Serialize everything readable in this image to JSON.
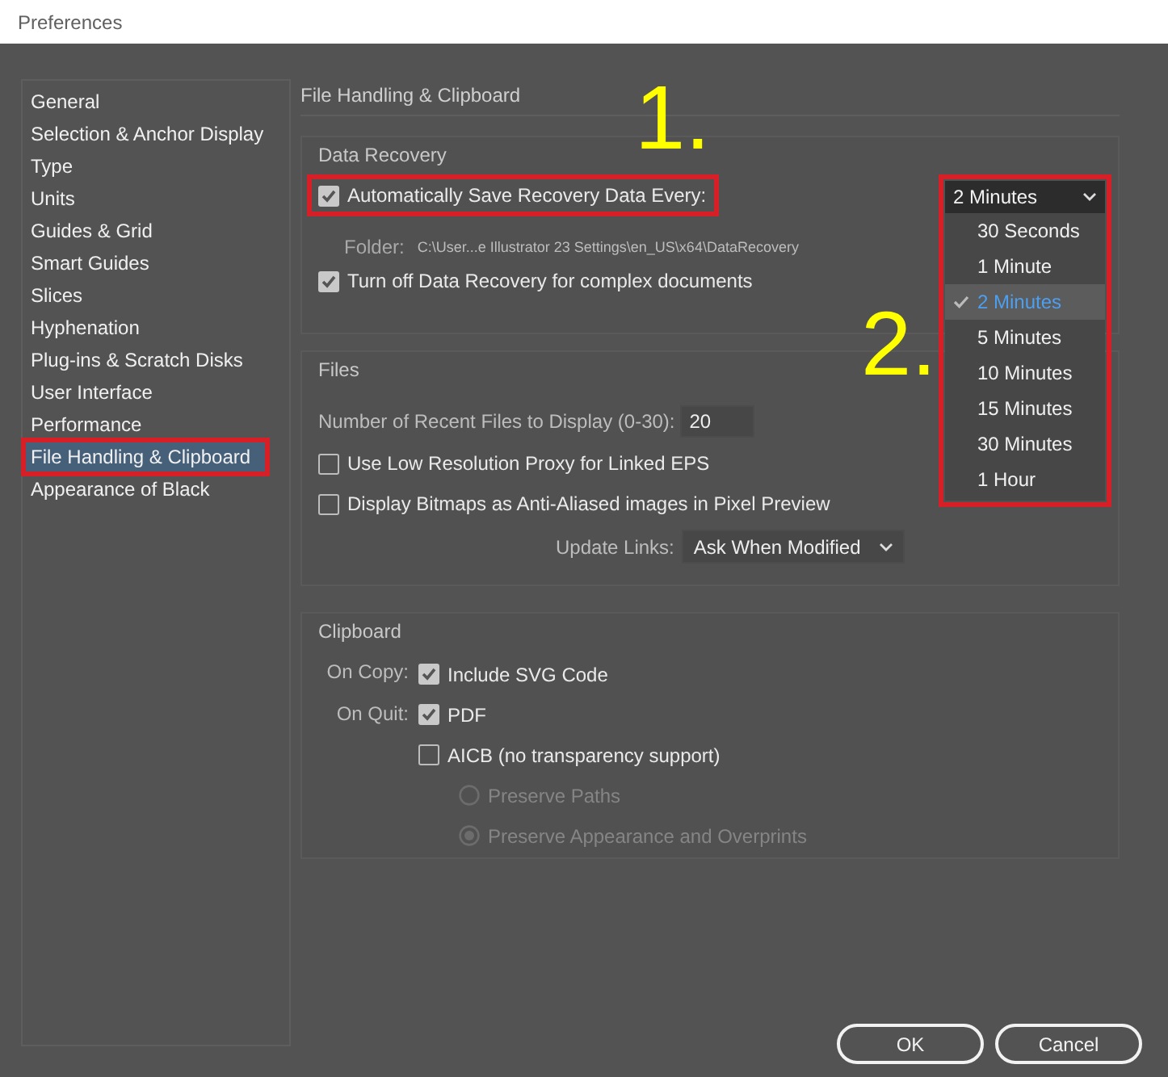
{
  "window": {
    "title": "Preferences"
  },
  "sidebar": {
    "items": [
      {
        "label": "General",
        "selected": false,
        "highlighted": false
      },
      {
        "label": "Selection & Anchor Display",
        "selected": false,
        "highlighted": false
      },
      {
        "label": "Type",
        "selected": false,
        "highlighted": false
      },
      {
        "label": "Units",
        "selected": false,
        "highlighted": false
      },
      {
        "label": "Guides & Grid",
        "selected": false,
        "highlighted": false
      },
      {
        "label": "Smart Guides",
        "selected": false,
        "highlighted": false
      },
      {
        "label": "Slices",
        "selected": false,
        "highlighted": false
      },
      {
        "label": "Hyphenation",
        "selected": false,
        "highlighted": false
      },
      {
        "label": "Plug-ins & Scratch Disks",
        "selected": false,
        "highlighted": false
      },
      {
        "label": "User Interface",
        "selected": false,
        "highlighted": false
      },
      {
        "label": "Performance",
        "selected": false,
        "highlighted": false
      },
      {
        "label": "File Handling & Clipboard",
        "selected": true,
        "highlighted": true
      },
      {
        "label": "Appearance of Black",
        "selected": false,
        "highlighted": false
      }
    ]
  },
  "page_title": "File Handling & Clipboard",
  "data_recovery": {
    "title": "Data Recovery",
    "auto_save": {
      "label": "Automatically Save Recovery Data Every:",
      "checked": true,
      "highlighted": true
    },
    "interval": {
      "value": "2 Minutes",
      "expanded": true,
      "highlighted": true,
      "options": [
        {
          "label": "30 Seconds",
          "selected": false
        },
        {
          "label": "1 Minute",
          "selected": false
        },
        {
          "label": "2 Minutes",
          "selected": true
        },
        {
          "label": "5 Minutes",
          "selected": false
        },
        {
          "label": "10 Minutes",
          "selected": false
        },
        {
          "label": "15 Minutes",
          "selected": false
        },
        {
          "label": "30 Minutes",
          "selected": false
        },
        {
          "label": "1 Hour",
          "selected": false
        }
      ]
    },
    "folder_label": "Folder:",
    "folder_path": "C:\\User...e Illustrator 23 Settings\\en_US\\x64\\DataRecovery",
    "turn_off": {
      "label": "Turn off Data Recovery for complex documents",
      "checked": true
    }
  },
  "files": {
    "title": "Files",
    "recent_label": "Number of Recent Files to Display (0-30):",
    "recent_value": "20",
    "options": [
      {
        "label": "Use Low Resolution Proxy for Linked EPS",
        "checked": false
      },
      {
        "label": "Display Bitmaps as Anti-Aliased images in Pixel Preview",
        "checked": false
      }
    ],
    "update_links_label": "Update Links:",
    "update_links_value": "Ask When Modified"
  },
  "clipboard": {
    "title": "Clipboard",
    "on_copy_label": "On Copy:",
    "on_copy": [
      {
        "label": "Include SVG Code",
        "checked": true
      }
    ],
    "on_quit_label": "On Quit:",
    "on_quit": [
      {
        "label": "PDF",
        "checked": true
      },
      {
        "label": "AICB (no transparency support)",
        "checked": false
      }
    ],
    "aicb_options": [
      {
        "label": "Preserve Paths",
        "selected": false,
        "disabled": true
      },
      {
        "label": "Preserve Appearance and Overprints",
        "selected": true,
        "disabled": true
      }
    ]
  },
  "annotations": [
    {
      "text": "1."
    },
    {
      "text": "2."
    }
  ],
  "buttons": [
    {
      "label": "OK"
    },
    {
      "label": "Cancel"
    }
  ]
}
